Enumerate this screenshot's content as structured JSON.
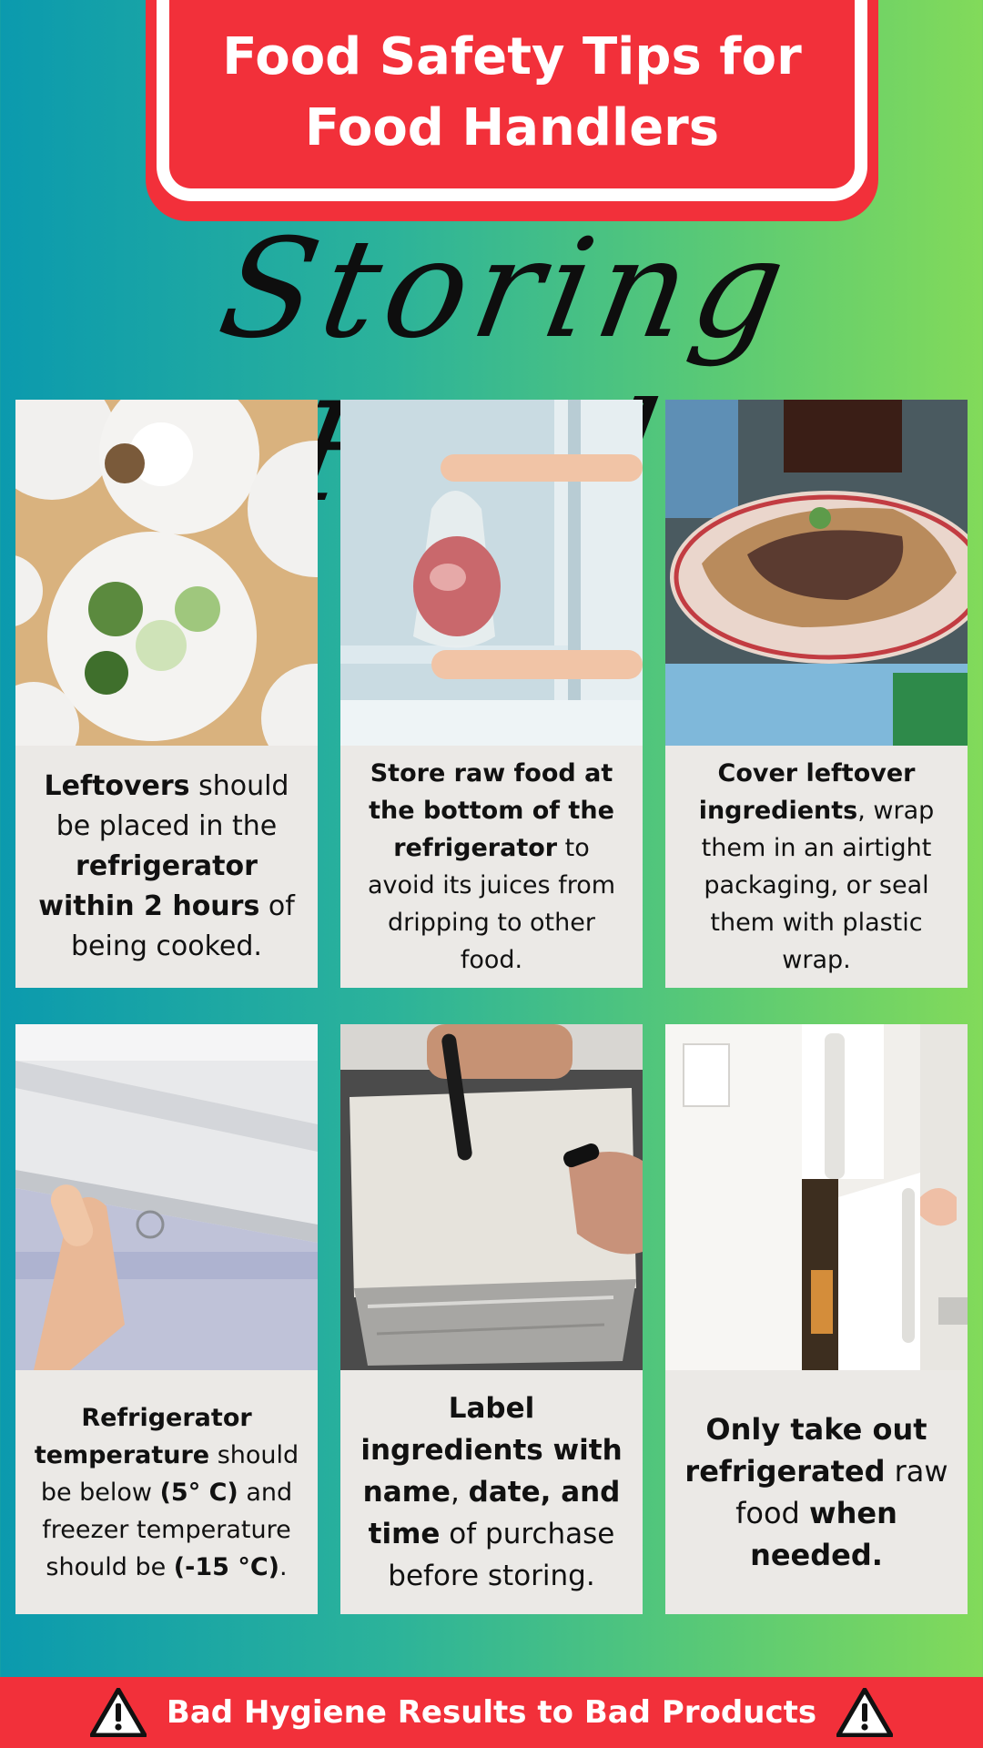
{
  "header": {
    "title": "Food Safety Tips for\nFood Handlers"
  },
  "subtitle": "Storing Food",
  "colors": {
    "accent_red": "#f2303a",
    "card_bg": "#ebe9e6",
    "gradient_left": "#0b9aae",
    "gradient_right": "#82da5a"
  },
  "cards": [
    {
      "photo": "plates-of-leftover-food",
      "parts": [
        {
          "t": "Leftovers",
          "b": true
        },
        {
          "t": " should be placed in the ",
          "b": false
        },
        {
          "t": "refrigerator within 2 hours",
          "b": true
        },
        {
          "t": " of being cooked.",
          "b": false
        }
      ]
    },
    {
      "photo": "raw-meat-bag-in-fridge",
      "parts": [
        {
          "t": "Store raw food at the bottom of the refrigerator",
          "b": true
        },
        {
          "t": " to avoid its juices from dripping to other food.",
          "b": false
        }
      ]
    },
    {
      "photo": "plastic-wrapped-pizza-plate",
      "parts": [
        {
          "t": "Cover leftover ingredients",
          "b": true
        },
        {
          "t": ", wrap them in an airtight packaging, or seal them with plastic wrap.",
          "b": false
        }
      ]
    },
    {
      "photo": "fridge-temperature-panel",
      "parts": [
        {
          "t": "Refrigerator temperature",
          "b": true
        },
        {
          "t": " should be below ",
          "b": false
        },
        {
          "t": "(5° C)",
          "b": true
        },
        {
          "t": " and freezer temperature should be ",
          "b": false
        },
        {
          "t": "(-15 °C)",
          "b": true
        },
        {
          "t": ".",
          "b": false
        }
      ]
    },
    {
      "photo": "labeling-wrapped-tray",
      "parts": [
        {
          "t": "Label ingredients with name",
          "b": true
        },
        {
          "t": ", ",
          "b": false
        },
        {
          "t": "date, and time",
          "b": true
        },
        {
          "t": " of purchase before storing.",
          "b": false
        }
      ]
    },
    {
      "photo": "opening-refrigerator-door",
      "parts": [
        {
          "t": "Only take out refrigerated",
          "b": true
        },
        {
          "t": " raw food ",
          "b": false
        },
        {
          "t": "when needed.",
          "b": true
        }
      ]
    }
  ],
  "footer": {
    "text": "Bad Hygiene Results to Bad Products",
    "icon": "warning-icon"
  }
}
